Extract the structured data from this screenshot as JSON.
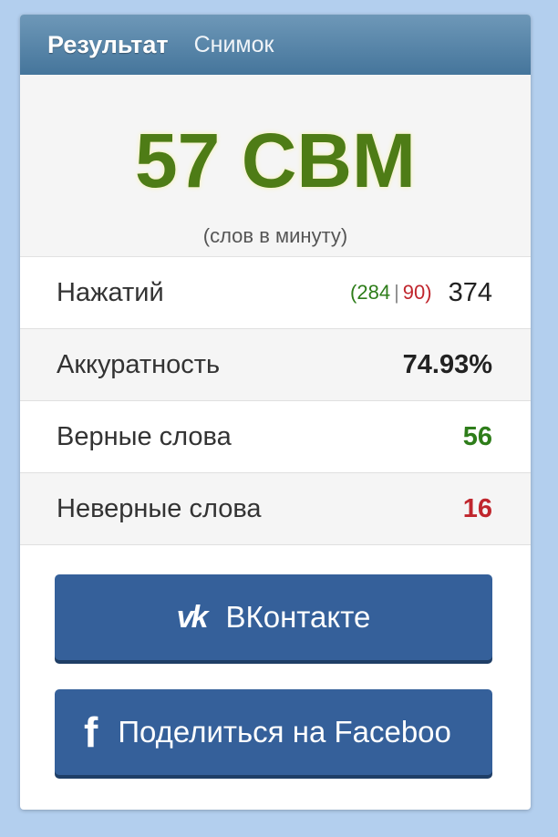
{
  "tabs": {
    "result": "Результат",
    "snapshot": "Снимок"
  },
  "score": {
    "value": "57 СВМ",
    "unit": "(слов в минуту)"
  },
  "stats": {
    "keystrokes": {
      "label": "Нажатий",
      "open": "(",
      "correct": "284",
      "sep": "|",
      "wrong": "90",
      "close": ")",
      "total": "374"
    },
    "accuracy": {
      "label": "Аккуратность",
      "value": "74.93%"
    },
    "correct_words": {
      "label": "Верные слова",
      "value": "56"
    },
    "wrong_words": {
      "label": "Неверные слова",
      "value": "16"
    }
  },
  "share": {
    "vk": {
      "icon": "vk-logo-icon",
      "glyph": "vk",
      "label": "ВКонтакте"
    },
    "facebook": {
      "icon": "facebook-logo-icon",
      "glyph": "f",
      "label": "Поделиться на Faceboo"
    }
  },
  "colors": {
    "score": "#4e7c16",
    "correct": "#2e7d1a",
    "wrong": "#c0262d",
    "button": "#35609a",
    "header": "#45759b"
  }
}
